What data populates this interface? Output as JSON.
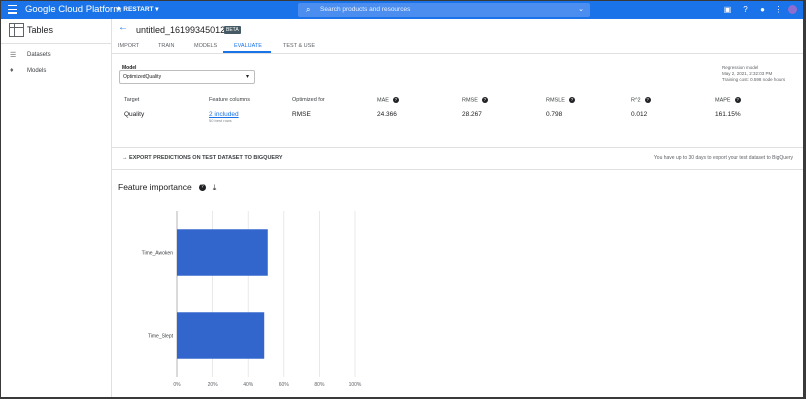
{
  "header": {
    "brand": "Google Cloud Platform",
    "project": "RESTART",
    "search_placeholder": "Search products and resources",
    "icons": [
      "menu-icon",
      "search-icon",
      "chevron-down-icon",
      "terminal-icon",
      "help-icon",
      "notifications-icon",
      "more-vert-icon",
      "avatar"
    ]
  },
  "sidebar": {
    "title": "Tables",
    "items": [
      {
        "label": "Datasets",
        "icon": "list-icon"
      },
      {
        "label": "Models",
        "icon": "lightbulb-icon"
      }
    ]
  },
  "dataset": {
    "name": "untitled_1619934501220",
    "badge": "BETA"
  },
  "tabs": [
    {
      "label": "IMPORT",
      "active": false
    },
    {
      "label": "TRAIN",
      "active": false
    },
    {
      "label": "MODELS",
      "active": false
    },
    {
      "label": "EVALUATE",
      "active": true
    },
    {
      "label": "TEST & USE",
      "active": false
    }
  ],
  "model": {
    "label": "Model",
    "value": "OptimizedQuality"
  },
  "model_meta": {
    "type": "Regression model",
    "date": "May 2, 2021, 2:32:03 PM",
    "budget": "Training cost: 0.598 node hours"
  },
  "metrics": {
    "headers": [
      "Target",
      "Feature columns",
      "Optimized for",
      "MAE",
      "RMSE",
      "RMSLE",
      "R^2",
      "MAPE"
    ],
    "values": [
      "Quality",
      "2 included",
      "RMSE",
      "24.366",
      "28.267",
      "0.798",
      "0.012",
      "161.15%"
    ],
    "feature_sub": "50 best rows"
  },
  "export": {
    "label": "EXPORT PREDICTIONS ON TEST DATASET TO BIGQUERY",
    "note": "You have up to 30 days to export your test dataset to BigQuery"
  },
  "feature_importance": {
    "title": "Feature importance"
  },
  "colors": {
    "accent": "#1a73e8",
    "bar": "#3366cc"
  },
  "chart_data": {
    "type": "bar",
    "orientation": "horizontal",
    "categories": [
      "Time_Awoken",
      "Time_Slept"
    ],
    "values": [
      51,
      49
    ],
    "xlim": [
      0,
      100
    ],
    "xticks": [
      "0%",
      "20%",
      "40%",
      "60%",
      "80%",
      "100%"
    ],
    "grid": true
  }
}
